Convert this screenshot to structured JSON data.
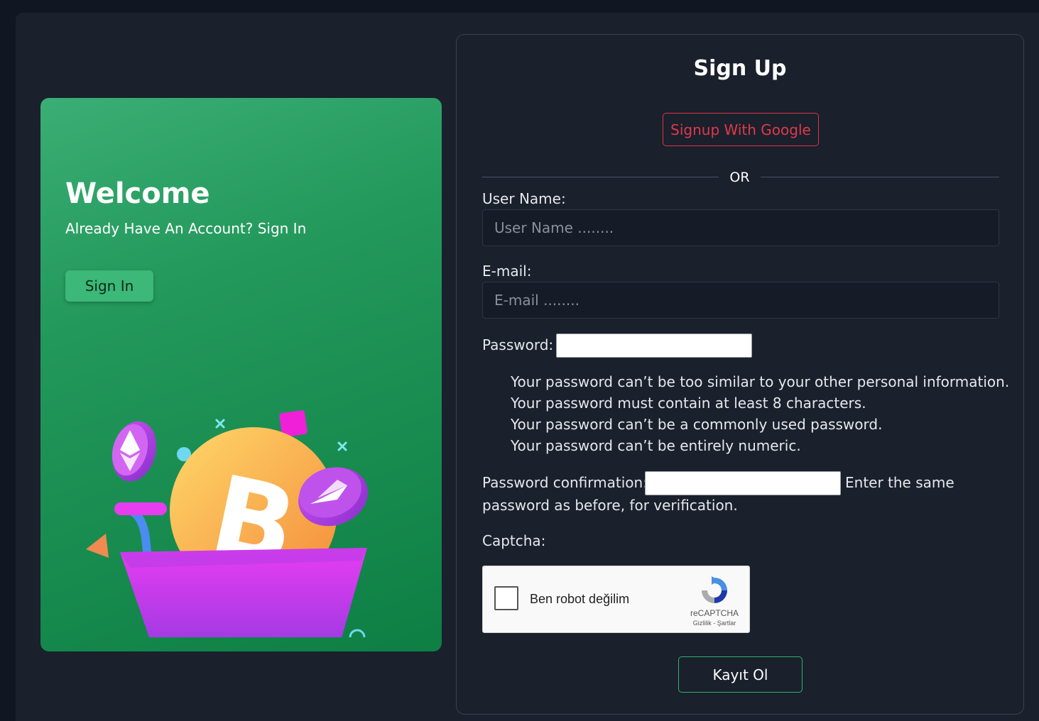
{
  "welcome": {
    "title": "Welcome",
    "subtitle": "Already Have An Account? Sign In",
    "signin_label": "Sign In"
  },
  "signup": {
    "title": "Sign Up",
    "google_label": "Signup With Google",
    "or_text": "OR",
    "username": {
      "label": "User Name:",
      "placeholder": "User Name ........"
    },
    "email": {
      "label": "E-mail:",
      "placeholder": "E-mail ........"
    },
    "password": {
      "label": "Password:",
      "help": [
        "Your password can’t be too similar to your other personal information.",
        "Your password must contain at least 8 characters.",
        "Your password can’t be a commonly used password.",
        "Your password can’t be entirely numeric."
      ]
    },
    "password_confirm": {
      "label": "Password confirmation:",
      "help_part1": "Enter the same",
      "help_part2": "password as before, for verification."
    },
    "captcha": {
      "label": "Captcha:",
      "checkbox_text": "Ben robot değilim",
      "brand": "reCAPTCHA",
      "terms": "Gizlilik - Şartlar"
    },
    "submit_label": "Kayıt Ol"
  },
  "colors": {
    "page_bg": "#1a202c",
    "welcome_green": "#23985b",
    "google_red": "#dc3545",
    "submit_border": "#2fb36b"
  },
  "icons": [
    "ethereum-coin-icon",
    "bitcoin-coin-icon",
    "shopping-cart-icon",
    "recaptcha-logo-icon"
  ]
}
